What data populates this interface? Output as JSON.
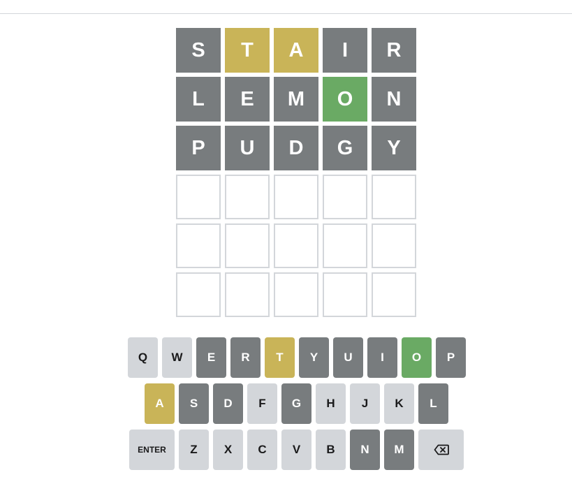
{
  "colors": {
    "correct": "#6aaa64",
    "present": "#c9b458",
    "absent": "#787c7e",
    "unused": "#d3d6da",
    "empty_border": "#d3d6da",
    "filled_text": "#ffffff",
    "key_text_dark": "#1a1a1b"
  },
  "board": {
    "rows": [
      {
        "tiles": [
          {
            "letter": "S",
            "state": "absent"
          },
          {
            "letter": "T",
            "state": "present"
          },
          {
            "letter": "A",
            "state": "present"
          },
          {
            "letter": "I",
            "state": "absent"
          },
          {
            "letter": "R",
            "state": "absent"
          }
        ]
      },
      {
        "tiles": [
          {
            "letter": "L",
            "state": "absent"
          },
          {
            "letter": "E",
            "state": "absent"
          },
          {
            "letter": "M",
            "state": "absent"
          },
          {
            "letter": "O",
            "state": "correct"
          },
          {
            "letter": "N",
            "state": "absent"
          }
        ]
      },
      {
        "tiles": [
          {
            "letter": "P",
            "state": "absent"
          },
          {
            "letter": "U",
            "state": "absent"
          },
          {
            "letter": "D",
            "state": "absent"
          },
          {
            "letter": "G",
            "state": "absent"
          },
          {
            "letter": "Y",
            "state": "absent"
          }
        ]
      },
      {
        "tiles": [
          {
            "letter": "",
            "state": "empty"
          },
          {
            "letter": "",
            "state": "empty"
          },
          {
            "letter": "",
            "state": "empty"
          },
          {
            "letter": "",
            "state": "empty"
          },
          {
            "letter": "",
            "state": "empty"
          }
        ]
      },
      {
        "tiles": [
          {
            "letter": "",
            "state": "empty"
          },
          {
            "letter": "",
            "state": "empty"
          },
          {
            "letter": "",
            "state": "empty"
          },
          {
            "letter": "",
            "state": "empty"
          },
          {
            "letter": "",
            "state": "empty"
          }
        ]
      },
      {
        "tiles": [
          {
            "letter": "",
            "state": "empty"
          },
          {
            "letter": "",
            "state": "empty"
          },
          {
            "letter": "",
            "state": "empty"
          },
          {
            "letter": "",
            "state": "empty"
          },
          {
            "letter": "",
            "state": "empty"
          }
        ]
      }
    ]
  },
  "keyboard": {
    "rows": [
      {
        "keys": [
          {
            "label": "Q",
            "state": "unused"
          },
          {
            "label": "W",
            "state": "unused"
          },
          {
            "label": "E",
            "state": "absent"
          },
          {
            "label": "R",
            "state": "absent"
          },
          {
            "label": "T",
            "state": "present"
          },
          {
            "label": "Y",
            "state": "absent"
          },
          {
            "label": "U",
            "state": "absent"
          },
          {
            "label": "I",
            "state": "absent"
          },
          {
            "label": "O",
            "state": "correct"
          },
          {
            "label": "P",
            "state": "absent"
          }
        ]
      },
      {
        "keys": [
          {
            "label": "A",
            "state": "present"
          },
          {
            "label": "S",
            "state": "absent"
          },
          {
            "label": "D",
            "state": "absent"
          },
          {
            "label": "F",
            "state": "unused"
          },
          {
            "label": "G",
            "state": "absent"
          },
          {
            "label": "H",
            "state": "unused"
          },
          {
            "label": "J",
            "state": "unused"
          },
          {
            "label": "K",
            "state": "unused"
          },
          {
            "label": "L",
            "state": "absent"
          }
        ]
      },
      {
        "keys": [
          {
            "label": "ENTER",
            "state": "unused",
            "kind": "enter"
          },
          {
            "label": "Z",
            "state": "unused"
          },
          {
            "label": "X",
            "state": "unused"
          },
          {
            "label": "C",
            "state": "unused"
          },
          {
            "label": "V",
            "state": "unused"
          },
          {
            "label": "B",
            "state": "unused"
          },
          {
            "label": "N",
            "state": "absent"
          },
          {
            "label": "M",
            "state": "absent"
          },
          {
            "label": "",
            "state": "unused",
            "kind": "backspace",
            "icon": "backspace-icon"
          }
        ]
      }
    ]
  }
}
